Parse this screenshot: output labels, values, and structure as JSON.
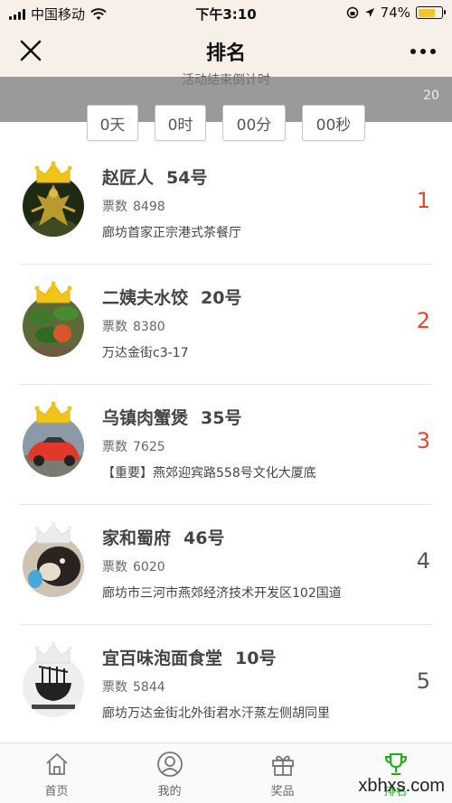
{
  "status_bar": {
    "carrier": "中国移动",
    "time": "下午3:10",
    "battery": "74%",
    "battery_level": 0.74
  },
  "nav": {
    "title": "排名"
  },
  "countdown": {
    "label": "活动结束倒计时",
    "overlay_text": "20",
    "days": "0天",
    "hours": "0时",
    "minutes": "00分",
    "seconds": "00秒"
  },
  "ranking": [
    {
      "name": "赵匠人",
      "number": "54号",
      "votes_label": "票数",
      "votes": "8498",
      "address": "廊坊首家正宗港式茶餐厅",
      "rank": "1",
      "crown": "gold",
      "avatar_icon": "figurine-image"
    },
    {
      "name": "二姨夫水饺",
      "number": "20号",
      "votes_label": "票数",
      "votes": "8380",
      "address": "万达金街c3-17",
      "rank": "2",
      "crown": "gold",
      "avatar_icon": "plant-image"
    },
    {
      "name": "乌镇肉蟹煲",
      "number": "35号",
      "votes_label": "票数",
      "votes": "7625",
      "address": "【重要】燕郊迎宾路558号文化大厦底",
      "rank": "3",
      "crown": "gold",
      "avatar_icon": "red-car-image"
    },
    {
      "name": "家和蜀府",
      "number": "46号",
      "votes_label": "票数",
      "votes": "6020",
      "address": "廊坊市三河市燕郊经济技术开发区102国道",
      "rank": "4",
      "crown": "silver",
      "avatar_icon": "dog-image"
    },
    {
      "name": "宜百味泡面食堂",
      "number": "10号",
      "votes_label": "票数",
      "votes": "5844",
      "address": "廊坊万达金街北外街君水汗蒸左侧胡同里",
      "rank": "5",
      "crown": "silver",
      "avatar_icon": "noodle-logo-image"
    }
  ],
  "tabs": [
    {
      "label": "首页",
      "icon": "home-icon"
    },
    {
      "label": "我的",
      "icon": "user-icon"
    },
    {
      "label": "奖品",
      "icon": "gift-icon"
    },
    {
      "label": "排名",
      "icon": "trophy-icon",
      "active": true
    }
  ],
  "watermark": "xbhxs.com",
  "colors": {
    "header_bg": "#f7f0e9",
    "rank_top": "#e8462f",
    "crown_gold": "#f0c419",
    "crown_silver": "#e2e2e2",
    "tab_active": "#1aad19"
  }
}
